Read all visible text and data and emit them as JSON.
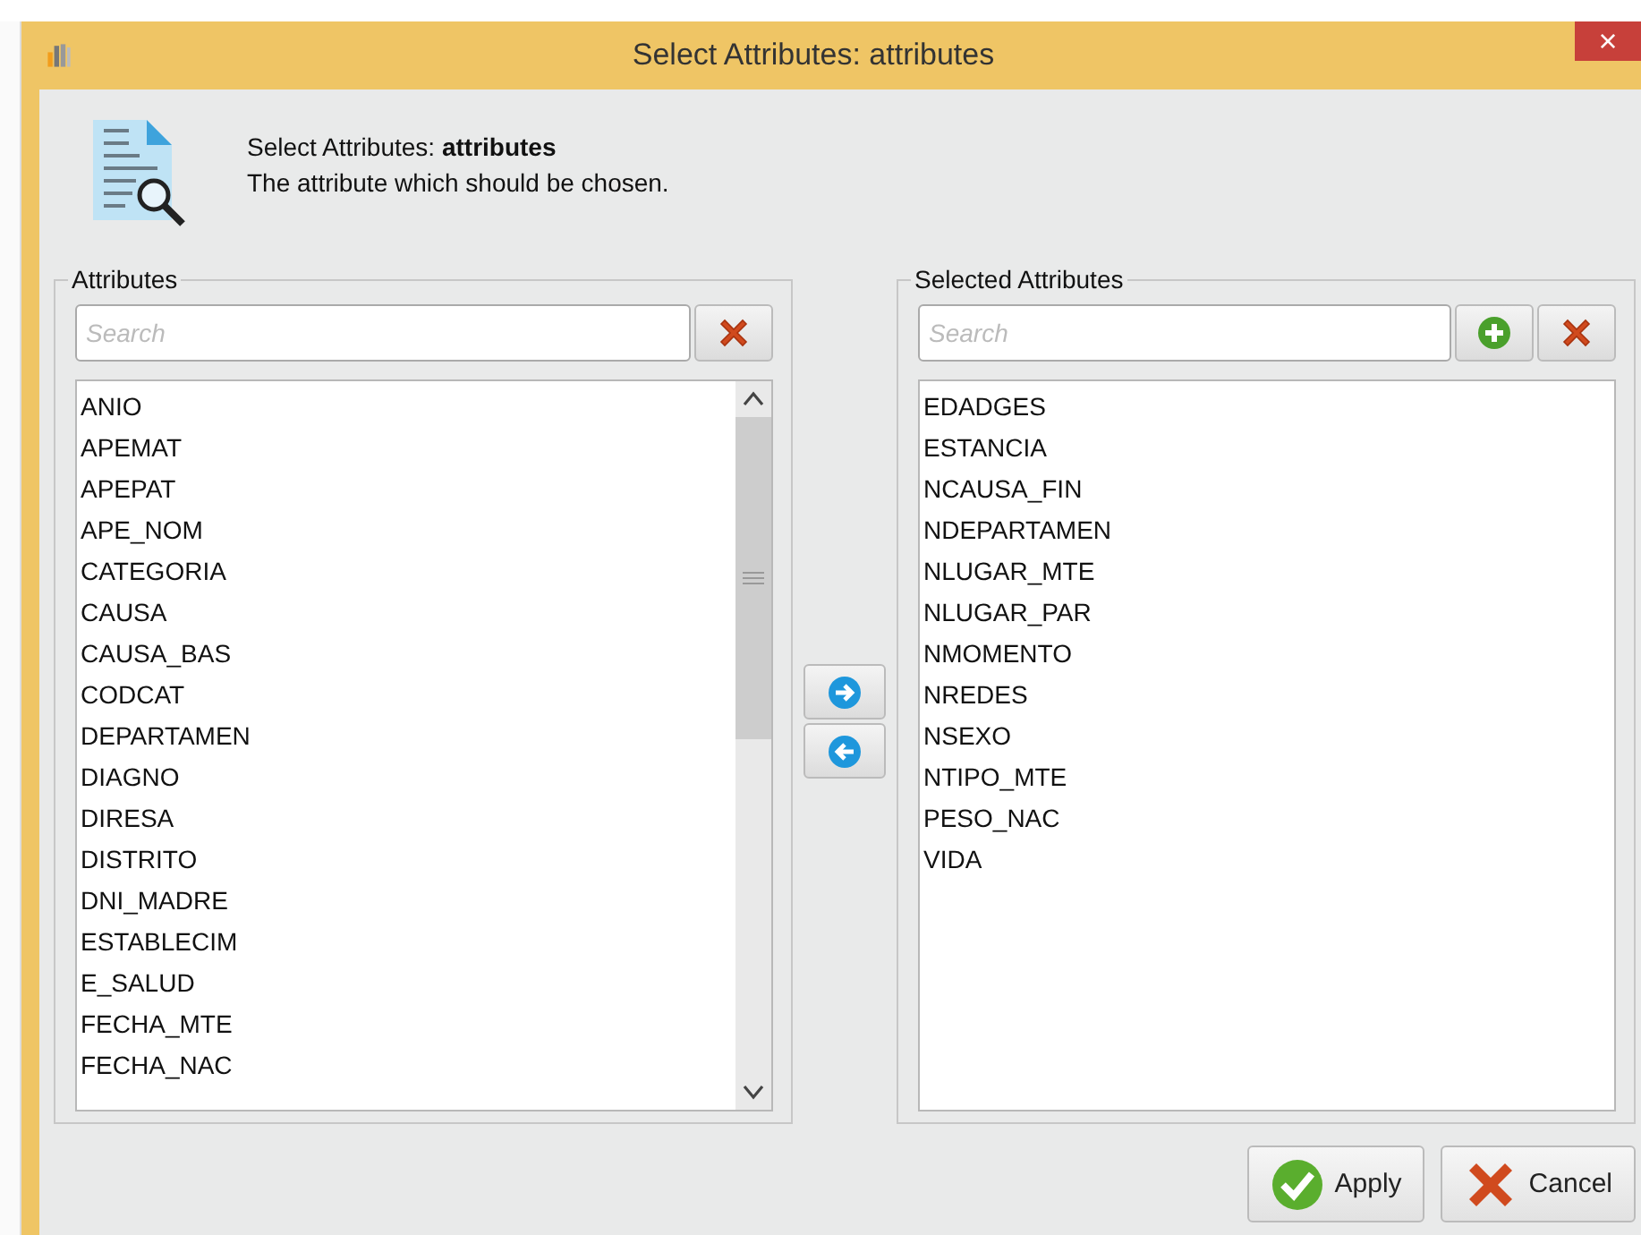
{
  "window": {
    "title": "Select Attributes: attributes",
    "close_glyph": "×"
  },
  "header": {
    "title_prefix": "Select Attributes: ",
    "title_bold": "attributes",
    "description": "The attribute which should be chosen."
  },
  "available": {
    "legend": "Attributes",
    "search": {
      "placeholder": "Search"
    },
    "items": [
      "ANIO",
      "APEMAT",
      "APEPAT",
      "APE_NOM",
      "CATEGORIA",
      "CAUSA",
      "CAUSA_BAS",
      "CODCAT",
      "DEPARTAMEN",
      "DIAGNO",
      "DIRESA",
      "DISTRITO",
      "DNI_MADRE",
      "ESTABLECIM",
      "E_SALUD",
      "FECHA_MTE",
      "FECHA_NAC"
    ]
  },
  "selected": {
    "legend": "Selected Attributes",
    "search": {
      "placeholder": "Search"
    },
    "items": [
      "EDADGES",
      "ESTANCIA",
      "NCAUSA_FIN",
      "NDEPARTAMEN",
      "NLUGAR_MTE",
      "NLUGAR_PAR",
      "NMOMENTO",
      "NREDES",
      "NSEXO",
      "NTIPO_MTE",
      "PESO_NAC",
      "VIDA"
    ]
  },
  "buttons": [
    {
      "label": "Apply",
      "kind": "apply"
    },
    {
      "label": "Cancel",
      "kind": "cancel"
    }
  ]
}
